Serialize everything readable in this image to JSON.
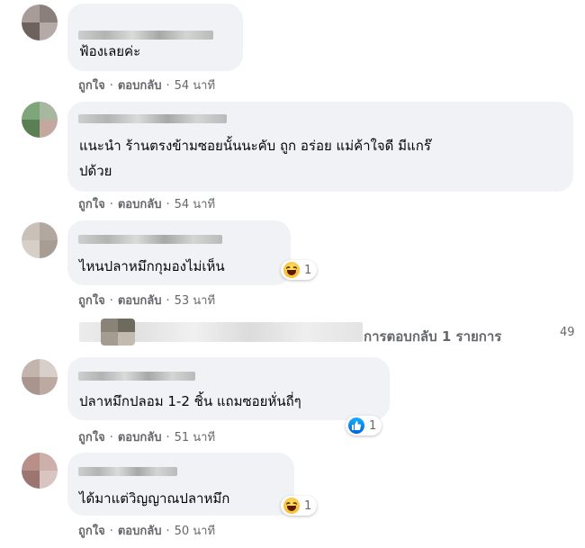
{
  "comments": [
    {
      "text_lines": [
        "ฟ้องเลยค่ะ"
      ],
      "like_label": "ถูกใจ",
      "reply_label": "ตอบกลับ",
      "time": "54 นาที"
    },
    {
      "text_lines": [
        "แนะนำ ร้านตรงข้ามซอยนั้นนะคับ ถูก อร่อย แม่ค้าใจดี มีแกร๊",
        "ปด้วย"
      ],
      "like_label": "ถูกใจ",
      "reply_label": "ตอบกลับ",
      "time": "54 นาที"
    },
    {
      "text_lines": [
        "ไหนปลาหมึกกุมองไม่เห็น"
      ],
      "like_label": "ถูกใจ",
      "reply_label": "ตอบกลับ",
      "time": "53 นาที",
      "reaction": {
        "icon": "haha-emoji-icon",
        "count": "1"
      }
    },
    {
      "text_lines": [
        "ปลาหมึกปลอม 1-2 ชิ้น แถมซอยหั่นถี่ๆ"
      ],
      "like_label": "ถูกใจ",
      "reply_label": "ตอบกลับ",
      "time": "51 นาที",
      "reaction": {
        "icon": "like-thumb-icon",
        "count": "1"
      }
    },
    {
      "text_lines": [
        "ได้มาแต่วิญญาณปลาหมึก"
      ],
      "like_label": "ถูกใจ",
      "reply_label": "ตอบกลับ",
      "time": "50 นาที",
      "reaction": {
        "icon": "haha-emoji-icon",
        "count": "1"
      }
    }
  ],
  "replies_summary": {
    "label": "การตอบกลับ 1 รายการ",
    "time": "49"
  },
  "colors": {
    "bubble": "#f0f2f5",
    "secondary_text": "#65676b",
    "primary_text": "#050505",
    "like_blue": "#1877f2"
  }
}
